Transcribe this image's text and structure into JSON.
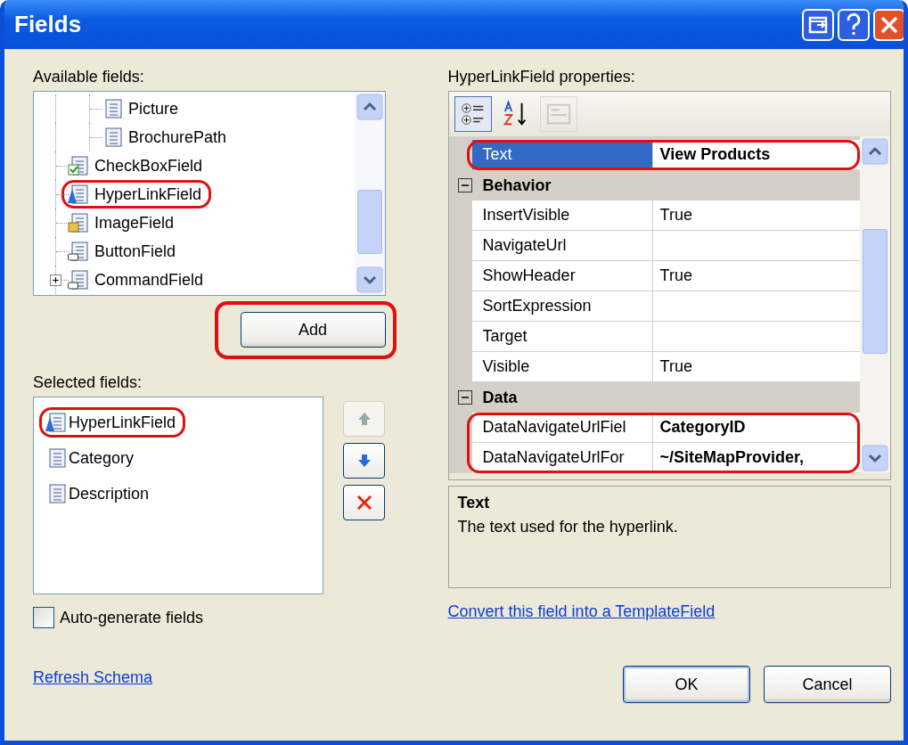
{
  "window": {
    "title": "Fields"
  },
  "available_fields": {
    "label": "Available fields:",
    "items": [
      {
        "children": [
          {
            "label": "Picture",
            "kind": "bound",
            "highlighted": false
          },
          {
            "label": "BrochurePath",
            "kind": "bound",
            "highlighted": false
          }
        ]
      },
      {
        "label": "CheckBoxField",
        "kind": "checkbox",
        "highlighted": false
      },
      {
        "label": "HyperLinkField",
        "kind": "hyperlink",
        "highlighted": true
      },
      {
        "label": "ImageField",
        "kind": "image",
        "highlighted": false
      },
      {
        "label": "ButtonField",
        "kind": "button",
        "highlighted": false
      },
      {
        "label": "CommandField",
        "kind": "command",
        "highlighted": false,
        "expanded": false
      }
    ]
  },
  "add_button": {
    "label": "Add",
    "highlighted": true
  },
  "selected_fields": {
    "label": "Selected fields:",
    "items": [
      {
        "label": "HyperLinkField",
        "kind": "hyperlink",
        "highlighted": true
      },
      {
        "label": "Category",
        "kind": "bound",
        "highlighted": false
      },
      {
        "label": "Description",
        "kind": "bound",
        "highlighted": false
      }
    ]
  },
  "move_buttons": [
    {
      "kind": "up",
      "disabled": true
    },
    {
      "kind": "down",
      "disabled": false
    },
    {
      "kind": "delete",
      "disabled": false
    }
  ],
  "auto_generate": {
    "label": "Auto-generate fields",
    "checked": false
  },
  "refresh_link": "Refresh Schema",
  "properties": {
    "label": "HyperLinkField properties:",
    "toolbar": [
      {
        "kind": "categorized",
        "selected": true,
        "disabled": false
      },
      {
        "kind": "alphabetical",
        "selected": false,
        "disabled": false
      },
      {
        "kind": "pages",
        "selected": false,
        "disabled": true
      }
    ],
    "rows": [
      {
        "kind": "property",
        "name": "Text",
        "value": "View Products",
        "selected": true,
        "modified": true,
        "highlighted": true
      },
      {
        "kind": "category",
        "name": "Behavior",
        "expanded": true
      },
      {
        "kind": "property",
        "name": "InsertVisible",
        "value": "True",
        "selected": false,
        "modified": false,
        "highlighted": false
      },
      {
        "kind": "property",
        "name": "NavigateUrl",
        "selected": false,
        "highlighted": false
      },
      {
        "kind": "property",
        "name": "ShowHeader",
        "value": "True",
        "selected": false,
        "modified": false,
        "highlighted": false
      },
      {
        "kind": "property",
        "name": "SortExpression",
        "selected": false,
        "highlighted": false
      },
      {
        "kind": "property",
        "name": "Target",
        "selected": false,
        "highlighted": false
      },
      {
        "kind": "property",
        "name": "Visible",
        "value": "True",
        "selected": false,
        "modified": false,
        "highlighted": false
      },
      {
        "kind": "category",
        "name": "Data",
        "expanded": true
      },
      {
        "kind": "property",
        "name": "DataNavigateUrlFiel",
        "value": "CategoryID",
        "selected": false,
        "modified": true,
        "highlighted": true
      },
      {
        "kind": "property",
        "name": "DataNavigateUrlFor",
        "value": "~/SiteMapProvider,",
        "selected": false,
        "modified": true,
        "highlighted": true
      }
    ],
    "description": {
      "title": "Text",
      "text": "The text used for the hyperlink."
    }
  },
  "convert_link": "Convert this field into a TemplateField",
  "buttons": [
    {
      "label": "OK",
      "default": true
    },
    {
      "label": "Cancel",
      "default": false
    }
  ]
}
